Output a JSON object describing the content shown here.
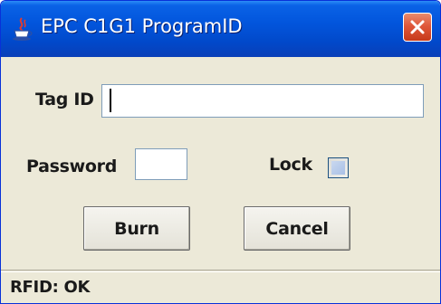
{
  "window": {
    "title": "EPC C1G1 ProgramID",
    "icon": "java-cup-icon",
    "close_icon": "close-icon",
    "accent_color": "#0255dc",
    "close_color": "#e0573a"
  },
  "form": {
    "tag_id_label": "Tag ID",
    "tag_id_value": "",
    "password_label": "Password",
    "password_value": "",
    "lock_label": "Lock",
    "lock_checked": false
  },
  "buttons": {
    "burn_label": "Burn",
    "cancel_label": "Cancel"
  },
  "status": {
    "text": "RFID: OK"
  }
}
